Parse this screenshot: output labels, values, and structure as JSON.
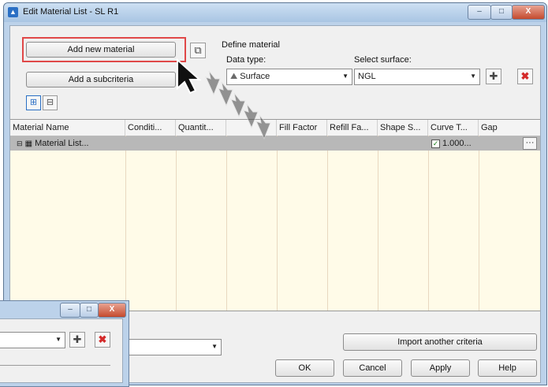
{
  "window": {
    "title": "Edit Material List - SL R1",
    "icon": "app-icon",
    "minimize": "–",
    "maximize": "□",
    "close": "X"
  },
  "buttons": {
    "add_material": "Add new material",
    "add_subcriteria": "Add a subcriteria",
    "import_criteria": "Import another criteria",
    "ok": "OK",
    "cancel": "Cancel",
    "apply": "Apply",
    "help": "Help"
  },
  "define": {
    "heading": "Define material",
    "data_type_label": "Data type:",
    "data_type_value": "Surface",
    "surface_label": "Select surface:",
    "surface_value": "NGL"
  },
  "table": {
    "columns": [
      "Material Name",
      "Conditi...",
      "Quantit...",
      "",
      "Fill Factor",
      "Refill Fa...",
      "Shape S...",
      "Curve T...",
      "Gap"
    ],
    "row": {
      "name": "Material List...",
      "curve": "1.000...",
      "curve_checked": true,
      "more": "···"
    }
  },
  "below_label": ":",
  "colors": {
    "highlight": "#e04848",
    "grid_bg": "#fffbe8",
    "selected_row": "#b8b8b8",
    "titlebar": "#bcd2ea"
  }
}
